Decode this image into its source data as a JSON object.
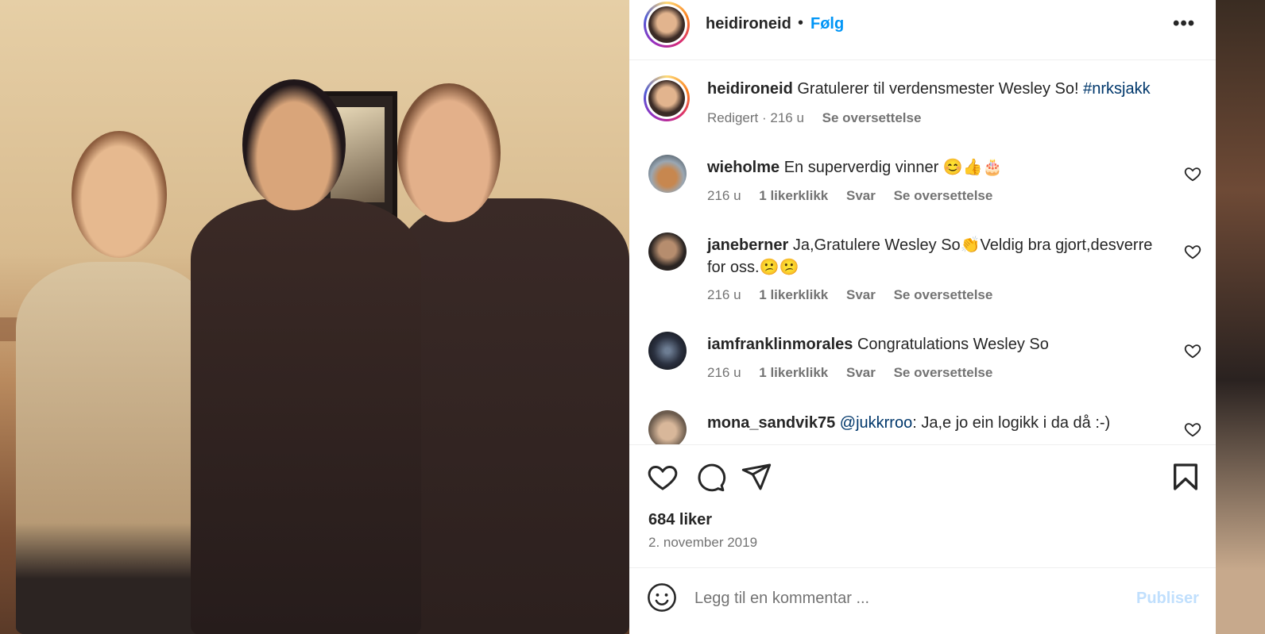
{
  "post": {
    "username": "heidironeid",
    "follow_label": "Følg",
    "more_icon": "more-horizontal-icon"
  },
  "caption": {
    "username": "heidironeid",
    "text": "Gratulerer til verdensmester Wesley So! ",
    "hashtag": "#nrksjakk",
    "edited": "Redigert",
    "age": "216 u",
    "translate": "Se oversettelse"
  },
  "comments": [
    {
      "username": "wieholme",
      "text": "En superverdig vinner 😊👍🎂",
      "age": "216 u",
      "likes": "1 likerklikk",
      "reply": "Svar",
      "translate": "Se oversettelse"
    },
    {
      "username": "janeberner",
      "text": "Ja,Gratulere Wesley So👏Veldig bra gjort,desverre for oss.😕😕",
      "age": "216 u",
      "likes": "1 likerklikk",
      "reply": "Svar",
      "translate": "Se oversettelse"
    },
    {
      "username": "iamfranklinmorales",
      "text": "Congratulations Wesley So",
      "age": "216 u",
      "likes": "1 likerklikk",
      "reply": "Svar",
      "translate": "Se oversettelse"
    },
    {
      "username": "mona_sandvik75",
      "mention": "@jukkrroo",
      "text": ": Ja,e jo ein logikk i da då :-)"
    }
  ],
  "stats": {
    "likes": "684 liker",
    "date": "2. november 2019"
  },
  "composer": {
    "placeholder": "Legg til en kommentar ...",
    "publish": "Publiser"
  },
  "colors": {
    "accent_blue": "#0095f6",
    "link": "#00376b",
    "text": "#262626",
    "muted": "#737373",
    "publish_disabled": "#c0dffd"
  }
}
